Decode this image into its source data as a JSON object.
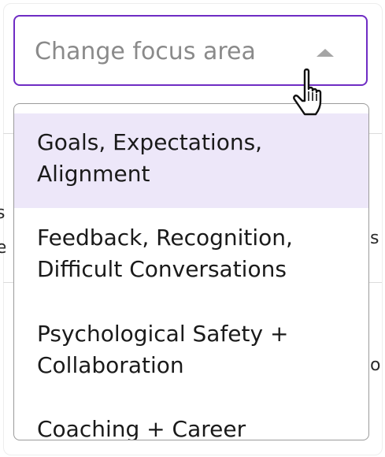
{
  "select": {
    "placeholder": "Change focus area"
  },
  "options": [
    {
      "label": "Goals, Expectations, Alignment",
      "selected": true
    },
    {
      "label": "Feedback, Recognition, Difficult Conversations",
      "selected": false
    },
    {
      "label": "Psychological Safety + Collaboration",
      "selected": false
    },
    {
      "label": "Coaching + Career",
      "selected": false
    }
  ],
  "background_fragments": {
    "left_top": "s",
    "left_bottom": "e",
    "right_top": "s",
    "right_mid": "or"
  },
  "icons": {
    "caret": "caret-up-icon",
    "cursor": "hand-pointer-cursor-icon"
  },
  "colors": {
    "accent": "#6f2cc4",
    "option_highlight": "#ede7f9",
    "placeholder_text": "#8a8a8a",
    "menu_border": "#9b9b9b",
    "text": "#1a1a1a"
  }
}
